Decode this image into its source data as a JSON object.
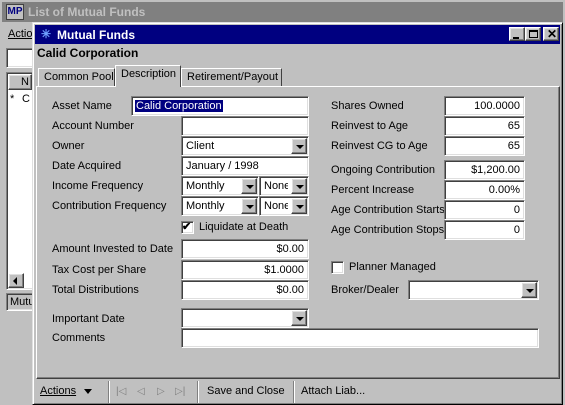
{
  "bg_window": {
    "title": "List of Mutual Funds",
    "menu_label": "Actio",
    "grid_header": "N",
    "grid_row_marker": "*",
    "grid_row_text": "C",
    "status_text": "Mutu"
  },
  "dialog": {
    "title": "Mutual Funds",
    "company": "Calid Corporation",
    "tabs": [
      "Common Pool",
      "Description",
      "Retirement/Payout"
    ],
    "active_tab": "Description"
  },
  "form": {
    "asset_name_label": "Asset Name",
    "asset_name": "Calid Corporation",
    "account_number_label": "Account Number",
    "account_number": "",
    "owner_label": "Owner",
    "owner": "Client",
    "date_acquired_label": "Date Acquired",
    "date_acquired": "January / 1998",
    "income_frequency_label": "Income Frequency",
    "income_frequency": "Monthly",
    "income_frequency2": "None",
    "contribution_frequency_label": "Contribution Frequency",
    "contribution_frequency": "Monthly",
    "contribution_frequency2": "None",
    "liquidate_label": "Liquidate at Death",
    "liquidate_checked": true,
    "amount_invested_label": "Amount Invested to Date",
    "amount_invested": "$0.00",
    "tax_cost_label": "Tax Cost per Share",
    "tax_cost": "$1.0000",
    "total_distributions_label": "Total Distributions",
    "total_distributions": "$0.00",
    "important_date_label": "Important Date",
    "important_date": "",
    "comments_label": "Comments",
    "comments": "",
    "shares_owned_label": "Shares Owned",
    "shares_owned": "100.0000",
    "reinvest_age_label": "Reinvest to Age",
    "reinvest_age": "65",
    "reinvest_cg_label": "Reinvest CG to Age",
    "reinvest_cg": "65",
    "ongoing_contribution_label": "Ongoing Contribution",
    "ongoing_contribution": "$1,200.00",
    "percent_increase_label": "Percent Increase",
    "percent_increase": "0.00%",
    "age_contrib_starts_label": "Age Contribution Starts",
    "age_contrib_starts": "0",
    "age_contrib_stops_label": "Age Contribution Stops",
    "age_contrib_stops": "0",
    "planner_managed_label": "Planner Managed",
    "planner_managed_checked": false,
    "broker_dealer_label": "Broker/Dealer",
    "broker_dealer": ""
  },
  "bottom": {
    "actions_label": "Actions",
    "save_close_label": "Save and Close",
    "attach_liab_label": "Attach Liab..."
  }
}
